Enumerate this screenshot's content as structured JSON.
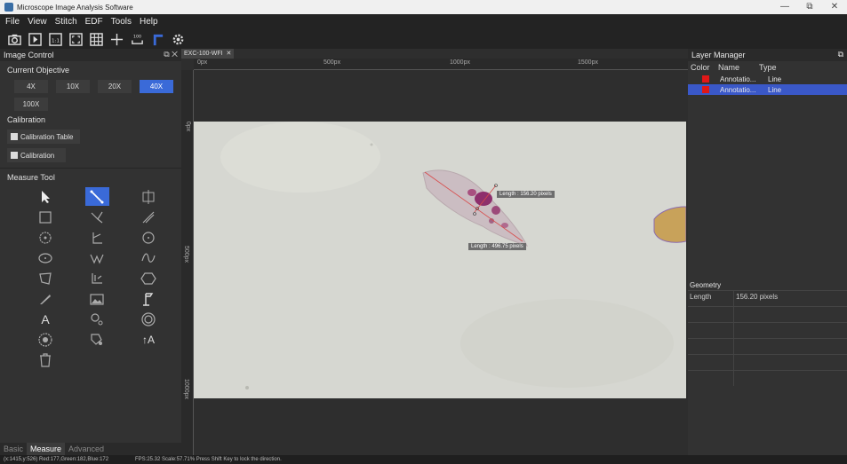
{
  "window": {
    "title": "Microscope Image Analysis Software",
    "controls": [
      "—",
      "⧉",
      "✕"
    ]
  },
  "menu": [
    "File",
    "View",
    "Stitch",
    "EDF",
    "Tools",
    "Help"
  ],
  "toolbar": {
    "icons": [
      "camera-icon",
      "video-icon",
      "scale-icon",
      "fullscreen-icon",
      "grid-icon",
      "crosshair-icon",
      "scalebar-icon",
      "ruler-icon",
      "settings-icon"
    ],
    "scalebar_text": "100"
  },
  "image_control": {
    "title": "Image Control",
    "header_controls": "⧉ ✕",
    "objective_label": "Current Objective",
    "objectives": [
      "4X",
      "10X",
      "20X",
      "40X",
      "100X"
    ],
    "active_objective": "40X",
    "calibration_label": "Calibration",
    "calibration_table_label": "Calibration Table",
    "calibration_button_label": "Calibration",
    "measure_tool_label": "Measure Tool"
  },
  "measure_tools": {
    "A_text": "A",
    "tA_text": "↑A"
  },
  "left_tabs": [
    "Basic",
    "Measure",
    "Advanced"
  ],
  "active_left_tab": "Measure",
  "document": {
    "tab_label": "EXC-100-WFI",
    "close": "✕",
    "ruler_labels": [
      "0px",
      "500px",
      "1000px",
      "1500px"
    ],
    "vruler_labels": [
      "0px",
      "500px",
      "1000px"
    ]
  },
  "measurements": [
    {
      "label": "Length : 156.20 pixels"
    },
    {
      "label": "Length : 496.75 pixels"
    }
  ],
  "layer_manager": {
    "title": "Layer Manager",
    "columns": [
      "Color",
      "Name",
      "Type"
    ],
    "rows": [
      {
        "color": "#e01818",
        "name": "Annotatio...",
        "type": "Line"
      },
      {
        "color": "#e01818",
        "name": "Annotatio...",
        "type": "Line"
      }
    ],
    "selected_row": 1
  },
  "geometry": {
    "title": "Geometry",
    "rows": [
      {
        "key": "Length",
        "value": "156.20 pixels"
      }
    ]
  },
  "status": {
    "coords": "(x:1415,y:526) Red:177,Green:182,Blue:172",
    "info": "FPS:25.32 Scale:57.71% Press Shift Key to lock the direction."
  },
  "colors": {
    "accent": "#3a6ad8",
    "selection": "#3a58c8",
    "annotation": "#e01818"
  }
}
